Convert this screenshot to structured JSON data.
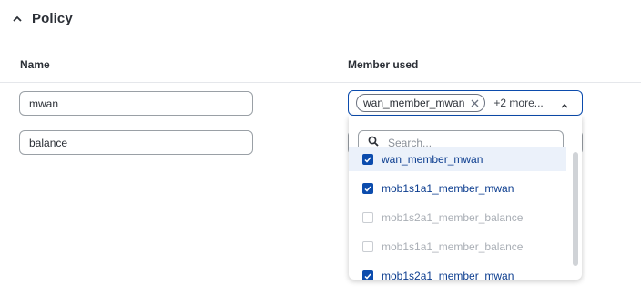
{
  "section": {
    "title": "Policy",
    "icon": "chevron-up-icon"
  },
  "table": {
    "columns": {
      "name": "Name",
      "member_used": "Member used"
    },
    "rows": [
      {
        "name": "mwan",
        "members": {
          "chips": [
            "wan_member_mwan"
          ],
          "more": "+2 more..."
        }
      },
      {
        "name": "balance"
      }
    ]
  },
  "dropdown": {
    "search_placeholder": "Search...",
    "options": [
      {
        "label": "wan_member_mwan",
        "checked": true,
        "disabled": false
      },
      {
        "label": "mob1s1a1_member_mwan",
        "checked": true,
        "disabled": false
      },
      {
        "label": "mob1s2a1_member_balance",
        "checked": false,
        "disabled": true
      },
      {
        "label": "mob1s1a1_member_balance",
        "checked": false,
        "disabled": true
      },
      {
        "label": "mob1s2a1_member_mwan",
        "checked": true,
        "disabled": false
      }
    ]
  },
  "colors": {
    "accent": "#0c4cad",
    "selected_text": "#0c3d8f",
    "disabled_text": "#a9aeb5",
    "hover_row": "#ebf1fa"
  }
}
